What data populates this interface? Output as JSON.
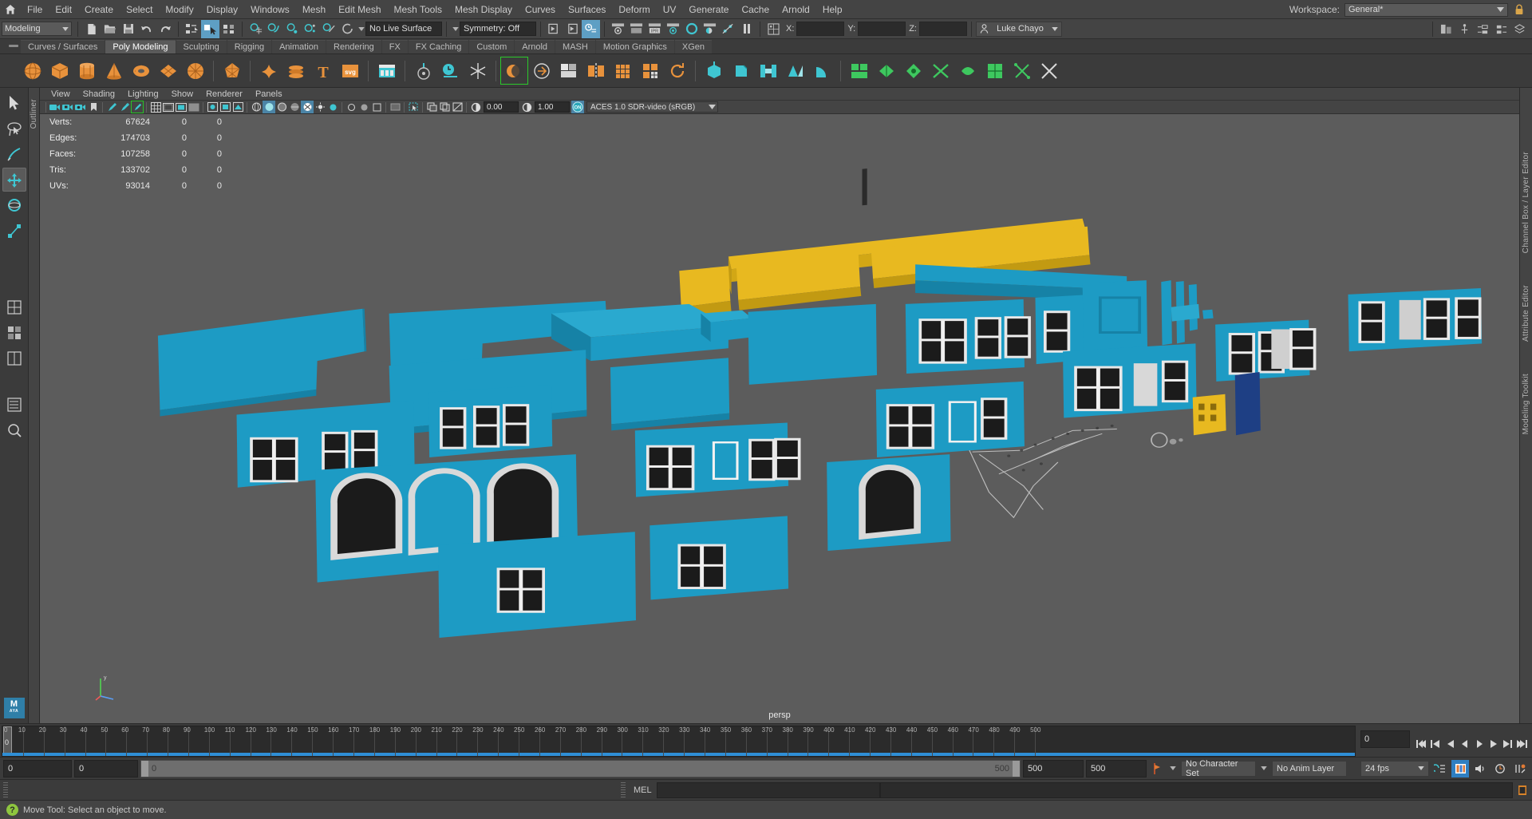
{
  "app": {
    "title": "Autodesk Maya",
    "home_icon": "home-icon"
  },
  "menubar": {
    "items": [
      "File",
      "Edit",
      "Create",
      "Select",
      "Modify",
      "Display",
      "Windows",
      "Mesh",
      "Edit Mesh",
      "Mesh Tools",
      "Mesh Display",
      "Curves",
      "Surfaces",
      "Deform",
      "UV",
      "Generate",
      "Cache",
      "Arnold",
      "Help"
    ],
    "workspace_label": "Workspace:",
    "workspace_value": "General*",
    "lock_icon": "lock-icon"
  },
  "statusline": {
    "menuset": "Modeling",
    "live_surface": "No Live Surface",
    "symmetry": "Symmetry: Off",
    "axis_x": "X:",
    "axis_y": "Y:",
    "axis_z": "Z:",
    "x_value": "",
    "y_value": "",
    "z_value": "",
    "user": "Luke Chayo",
    "user_icon": "person-icon",
    "icons": [
      "new-scene-icon",
      "open-scene-icon",
      "save-scene-icon",
      "undo-icon",
      "redo-icon",
      "select-hierarchy-icon",
      "select-object-icon",
      "select-component-icon",
      "snap-grid-icon",
      "snap-curve-icon",
      "snap-point-icon",
      "snap-projected-center-icon",
      "snap-view-plane-icon",
      "snap-make-live-icon",
      "history-input-icon",
      "history-output-icon",
      "construction-history-icon",
      "render-current-frame-icon",
      "ipr-render-icon",
      "render-settings-icon",
      "hypershade-icon",
      "render-view-icon",
      "light-editor-icon",
      "pause-icon",
      "relationship-editor-icon"
    ]
  },
  "shelf": {
    "tabs": [
      "Curves / Surfaces",
      "Poly Modeling",
      "Sculpting",
      "Rigging",
      "Animation",
      "Rendering",
      "FX",
      "FX Caching",
      "Custom",
      "Arnold",
      "MASH",
      "Motion Graphics",
      "XGen"
    ],
    "active_tab": "Poly Modeling",
    "grip_icon": "shelf-grip-icon",
    "items": [
      {
        "name": "poly-sphere-icon",
        "shape": "sphere"
      },
      {
        "name": "poly-cube-icon",
        "shape": "cube"
      },
      {
        "name": "poly-cylinder-icon",
        "shape": "cylinder"
      },
      {
        "name": "poly-cone-icon",
        "shape": "cone"
      },
      {
        "name": "poly-torus-icon",
        "shape": "torus"
      },
      {
        "name": "poly-plane-icon",
        "shape": "plane"
      },
      {
        "name": "poly-disc-icon",
        "shape": "disc"
      },
      {
        "name": "poly-platonic-icon",
        "shape": "platonic"
      },
      {
        "name": "poly-pyramid-icon",
        "shape": "star"
      },
      {
        "name": "poly-helix-icon",
        "shape": "helix"
      },
      {
        "name": "poly-type-icon",
        "shape": "type"
      },
      {
        "name": "poly-svg-icon",
        "shape": "svg"
      },
      {
        "name": "poly-multicut-icon",
        "shape": "grid"
      },
      {
        "name": "poly-target-weld-icon",
        "shape": "target"
      },
      {
        "name": "poly-quad-draw-icon",
        "shape": "clock"
      },
      {
        "name": "poly-snowflake-icon",
        "shape": "snow"
      },
      {
        "name": "poly-combine-icon",
        "shape": "combine"
      },
      {
        "name": "poly-separate-icon",
        "shape": "separate"
      },
      {
        "name": "poly-boolean-icon",
        "shape": "boolean"
      },
      {
        "name": "poly-mirror-icon",
        "shape": "mirror"
      },
      {
        "name": "poly-smooth-icon",
        "shape": "smooth"
      },
      {
        "name": "poly-reduce-icon",
        "shape": "reduce"
      },
      {
        "name": "poly-remesh-icon",
        "shape": "remesh"
      },
      {
        "name": "poly-extrude-icon",
        "shape": "extrude"
      },
      {
        "name": "poly-bevel-icon",
        "shape": "bevel"
      },
      {
        "name": "poly-bridge-icon",
        "shape": "bridge"
      },
      {
        "name": "poly-append-icon",
        "shape": "append"
      },
      {
        "name": "poly-wedge-icon",
        "shape": "wedge"
      },
      {
        "name": "poly-chamfer-icon",
        "shape": "chamfer"
      },
      {
        "name": "poly-circularize-icon",
        "shape": "circularize"
      },
      {
        "name": "poly-fill-hole-icon",
        "shape": "fill"
      },
      {
        "name": "poly-delete-edge-icon",
        "shape": "delete-edge"
      },
      {
        "name": "uv-editor-icon",
        "shape": "uv"
      },
      {
        "name": "uv-unfold-icon",
        "shape": "unfold"
      },
      {
        "name": "uv-layout-icon",
        "shape": "layout"
      },
      {
        "name": "uv-cut-icon",
        "shape": "cut"
      },
      {
        "name": "uv-sew-icon",
        "shape": "sew"
      },
      {
        "name": "uv-auto-icon",
        "shape": "auto"
      },
      {
        "name": "uv-planar-icon",
        "shape": "planar"
      },
      {
        "name": "uv-snapshot-icon",
        "shape": "snapshot"
      }
    ]
  },
  "toolbox": {
    "items": [
      {
        "name": "select-tool-icon",
        "selected": false
      },
      {
        "name": "lasso-select-tool-icon",
        "selected": false
      },
      {
        "name": "paint-select-tool-icon",
        "selected": false
      },
      {
        "name": "move-tool-icon",
        "selected": true
      },
      {
        "name": "rotate-tool-icon",
        "selected": false
      },
      {
        "name": "scale-tool-icon",
        "selected": false
      },
      {
        "name": "last-tool-icon",
        "selected": false
      },
      {
        "name": "layout-single-icon",
        "selected": false
      },
      {
        "name": "layout-four-view-icon",
        "selected": false
      },
      {
        "name": "layout-persp-outliner-icon",
        "selected": false
      },
      {
        "name": "layout-persp-graph-icon",
        "selected": false
      },
      {
        "name": "layout-hypershade-icon",
        "selected": false
      }
    ],
    "logo_text": "M",
    "logo_sub": "AYA"
  },
  "outliner_strip": {
    "label": "Outliner"
  },
  "right_strip": {
    "labels": [
      "Channel Box / Layer Editor",
      "Attribute Editor",
      "Modeling Toolkit"
    ]
  },
  "viewport": {
    "panel_menu": [
      "View",
      "Shading",
      "Lighting",
      "Show",
      "Renderer",
      "Panels"
    ],
    "exposure_value": "0.00",
    "gamma_value": "1.00",
    "color_mgmt_toggle": "ON",
    "color_space": "ACES 1.0 SDR-video (sRGB)",
    "camera_label": "persp",
    "hud": {
      "rows": [
        {
          "label": "Verts:",
          "total": "67624",
          "b": "0",
          "c": "0"
        },
        {
          "label": "Edges:",
          "total": "174703",
          "b": "0",
          "c": "0"
        },
        {
          "label": "Faces:",
          "total": "107258",
          "b": "0",
          "c": "0"
        },
        {
          "label": "Tris:",
          "total": "133702",
          "b": "0",
          "c": "0"
        },
        {
          "label": "UVs:",
          "total": "93014",
          "b": "0",
          "c": "0"
        }
      ]
    },
    "panel_icons": [
      "camera-attributes-icon",
      "camera-lock-icon",
      "camera-bookmark-icon",
      "image-plane-icon",
      "grease-pencil-icon",
      "grease-pencil-add-icon",
      "grease-pencil-edit-icon",
      "grid-icon",
      "film-gate-icon",
      "resolution-gate-icon",
      "gate-mask-icon",
      "xray-icon",
      "xray-joints-icon",
      "xray-active-components-icon",
      "wireframe-icon",
      "smooth-shade-icon",
      "flat-shade-icon",
      "wireframe-on-shaded-icon",
      "textured-icon",
      "lighting-icon",
      "shadows-icon",
      "ao-icon",
      "motion-blur-icon",
      "aa-icon",
      "isolate-select-icon",
      "viewport-snapshot-icon",
      "exposure-icon",
      "gamma-icon",
      "color-management-icon"
    ],
    "scene_accent": "#1d9bc4",
    "scene_accent2": "#e8b920",
    "bg_color": "#5c5c5c"
  },
  "timeslider": {
    "start_tick": "0",
    "ticks": [
      "10",
      "20",
      "30",
      "40",
      "50",
      "60",
      "70",
      "80",
      "90",
      "100",
      "110",
      "120",
      "130",
      "140",
      "150",
      "160",
      "170",
      "180",
      "190",
      "200",
      "210",
      "220",
      "230",
      "240",
      "250",
      "260",
      "270",
      "280",
      "290",
      "300",
      "310",
      "320",
      "330",
      "340",
      "350",
      "360",
      "370",
      "380",
      "390",
      "400",
      "410",
      "420",
      "430",
      "440",
      "450",
      "460",
      "470",
      "480",
      "490",
      "500"
    ],
    "current_frame_marker": "0",
    "current_frame_field": "0",
    "playback_icons": [
      "go-to-start-icon",
      "step-back-keyframe-icon",
      "step-back-frame-icon",
      "play-backwards-icon",
      "play-forwards-icon",
      "step-forward-frame-icon",
      "step-forward-keyframe-icon",
      "go-to-end-icon"
    ]
  },
  "rangeslider": {
    "anim_start": "0",
    "range_start": "0",
    "bar_left_value": "0",
    "bar_right_value": "500",
    "range_end": "500",
    "anim_end": "500",
    "auto_key_icon": "auto-keyframe-icon",
    "character_set": "No Character Set",
    "anim_layer": "No Anim Layer",
    "fps": "24 fps",
    "right_icons": [
      "animation-preferences-icon",
      "playback-range-icon",
      "audio-icon",
      "timeline-options-icon",
      "key-ticks-icon"
    ]
  },
  "cmdline": {
    "mel_label": "MEL",
    "input_value": "",
    "output_value": ""
  },
  "helpline": {
    "icon": "help-icon",
    "message": "Move Tool: Select an object to move."
  }
}
